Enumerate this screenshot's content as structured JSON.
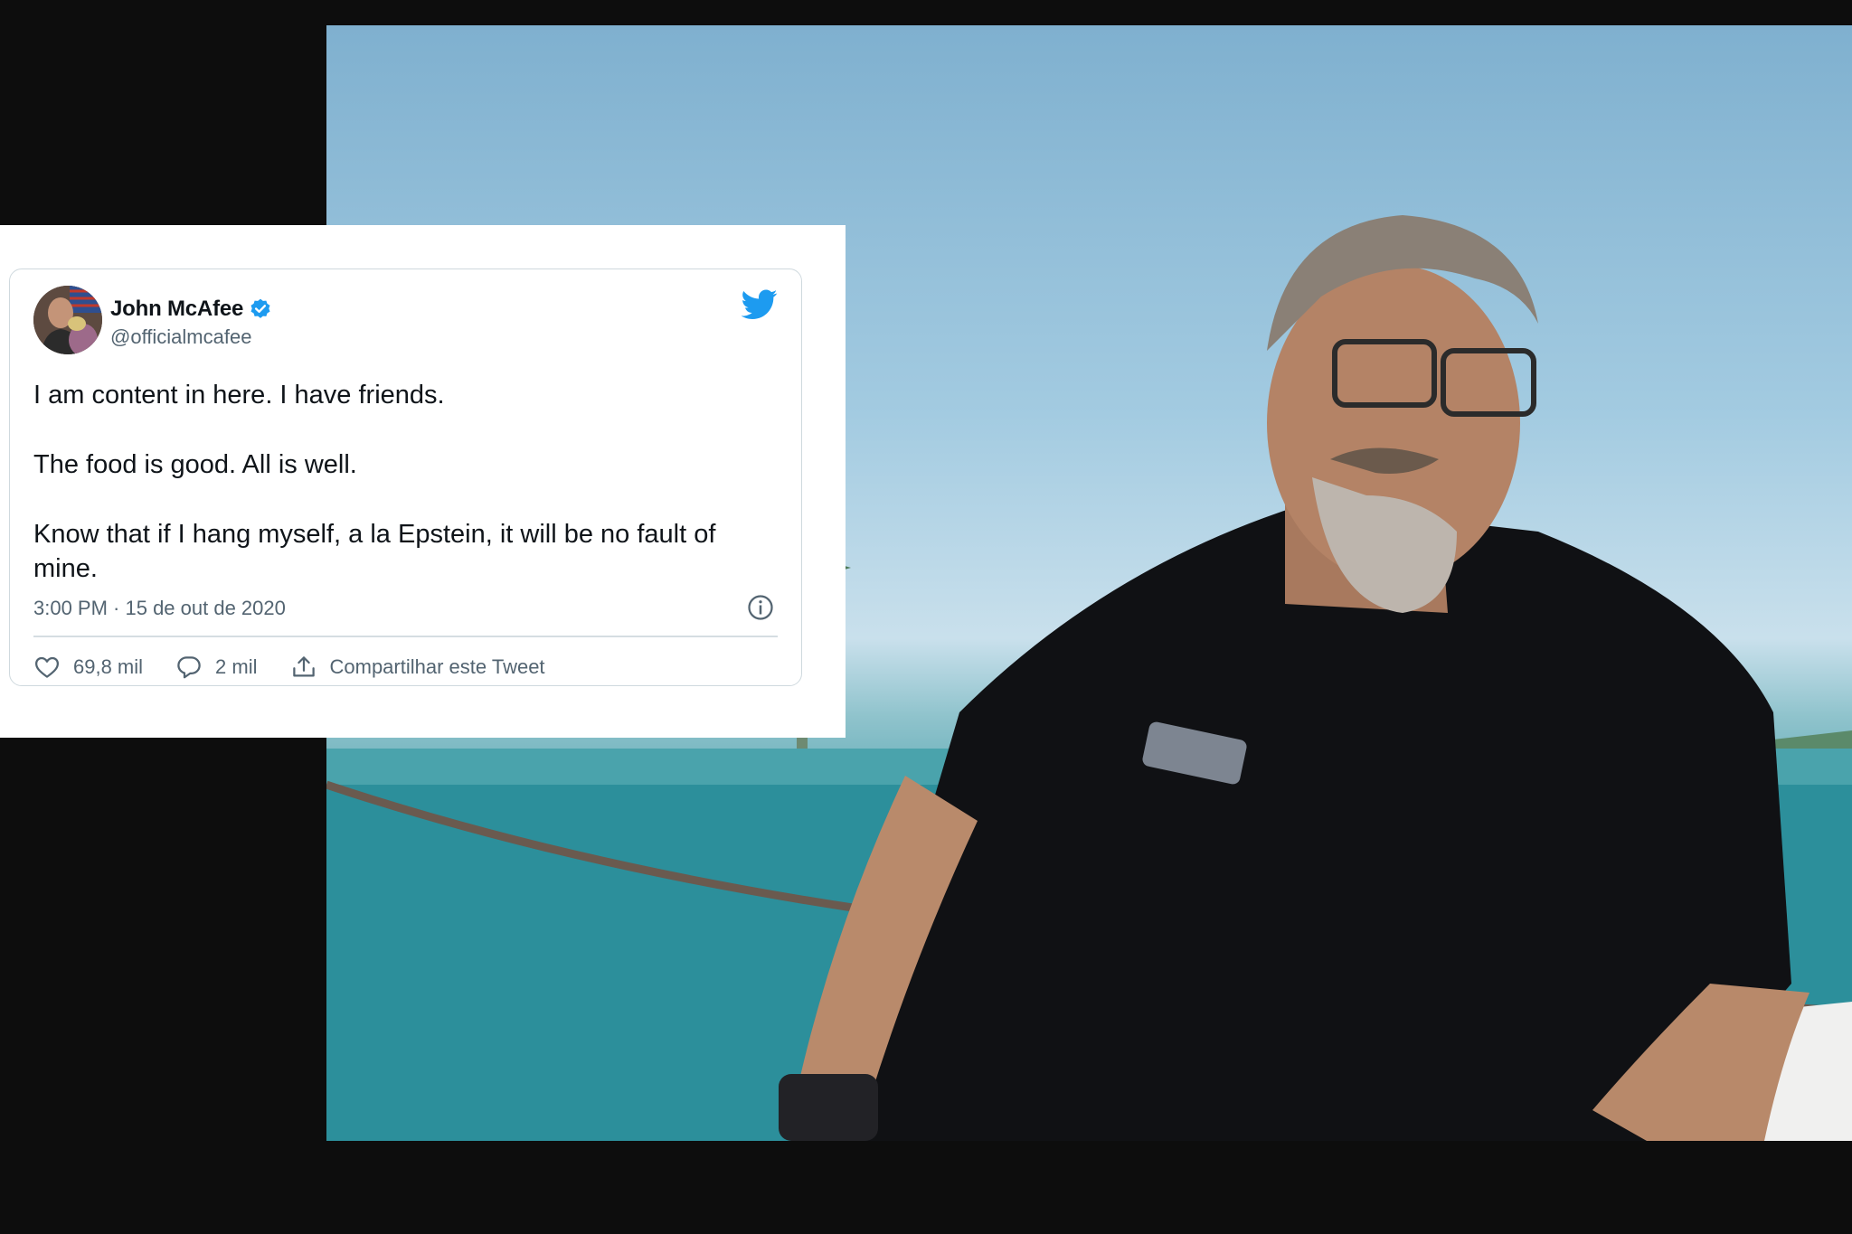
{
  "tweet": {
    "author_name": "John McAfee",
    "handle": "@officialmcafee",
    "paragraphs": [
      "I am content in here. I have friends.",
      "The food is good. All is well.",
      "Know that if I hang myself, a la Epstein, it will be no fault of mine."
    ],
    "timestamp": "3:00 PM · 15 de out de 2020",
    "likes": "69,8 mil",
    "replies": "2 mil",
    "share_label": "Compartilhar este Tweet",
    "icons": {
      "verified": "verified-badge-icon",
      "brand": "twitter-bird-icon",
      "info": "info-icon",
      "like": "heart-icon",
      "reply": "speech-bubble-icon",
      "share": "share-icon"
    },
    "colors": {
      "brand_blue": "#1d9bf0",
      "text_primary": "#0f1419",
      "text_secondary": "#536471",
      "border": "#cfd9de"
    }
  }
}
